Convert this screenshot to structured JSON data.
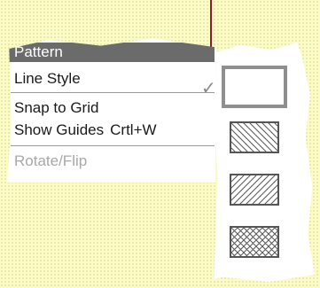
{
  "menu": {
    "items": [
      {
        "label": "Pattern"
      },
      {
        "label": "Line Style"
      },
      {
        "label": "Snap to Grid"
      },
      {
        "label": "Show Guides",
        "shortcut": "Crtl+W"
      },
      {
        "label": "Rotate/Flip"
      }
    ],
    "selected_index": 0,
    "disabled_index": 4
  },
  "palette": {
    "check_glyph": "✓",
    "patterns": [
      {
        "icon": "solid-pattern-icon",
        "selected": true
      },
      {
        "icon": "backslash-hatch-pattern-icon"
      },
      {
        "icon": "forward-hatch-pattern-icon"
      },
      {
        "icon": "crosshatch-pattern-icon"
      }
    ]
  },
  "colors": {
    "background": "#fbfbc8",
    "highlight": "#6b6b6b",
    "pointer": "#8a1c2c",
    "disabled_text": "#a8a8a8"
  }
}
